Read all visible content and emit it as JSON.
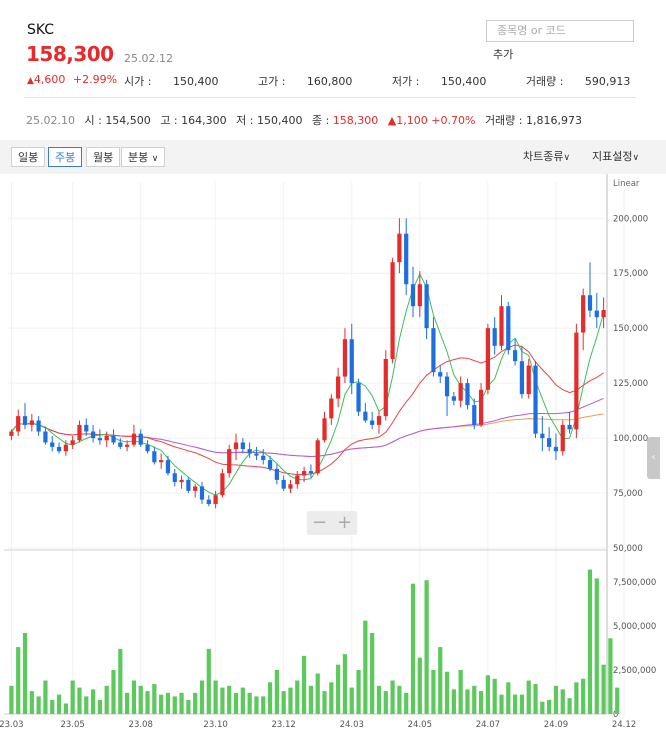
{
  "header": {
    "name": "SKC",
    "price": "158,300",
    "date": "25.02.12",
    "change": "4,600",
    "change_pct": "+2.99%",
    "open_label": "시가 :",
    "open": "150,400",
    "high_label": "고가 :",
    "high": "160,800",
    "low_label": "저가 :",
    "low": "150,400",
    "volume_label": "거래량 :",
    "volume": "590,913",
    "search_placeholder": "종목명 or 코드",
    "add_label": "추가"
  },
  "prev": {
    "date": "25.02.10",
    "open_label": "시 :",
    "open": "154,500",
    "high_label": "고 :",
    "high": "164,300",
    "low_label": "저 :",
    "low": "150,400",
    "close_label": "종 :",
    "close": "158,300",
    "change": "1,100",
    "change_pct": "+0.70%",
    "volume_label": "거래량 :",
    "volume": "1,816,973"
  },
  "toolbar": {
    "daily": "일봉",
    "weekly": "주봉",
    "monthly": "월봉",
    "minute": "분봉",
    "chart_type": "차트종류",
    "indicator": "지표설정"
  },
  "chart_data": {
    "type": "candlestick",
    "scale": "Linear",
    "price_axis": {
      "min": 50000,
      "max": 200000,
      "ticks": [
        50000,
        75000,
        100000,
        125000,
        150000,
        175000,
        200000
      ]
    },
    "volume_axis": {
      "min": 0,
      "max": 7500000,
      "ticks": [
        0,
        2500000,
        5000000,
        7500000
      ]
    },
    "x_ticks": [
      "23.03",
      "23.05",
      "23.08",
      "23.10",
      "23.12",
      "24.03",
      "24.05",
      "24.07",
      "24.09",
      "24.12"
    ],
    "x_tick_index": [
      0,
      9,
      19,
      30,
      40,
      50,
      60,
      70,
      80,
      90
    ],
    "colors": {
      "up": "#e52b2b",
      "down": "#1d6fe0",
      "volume": "#5cc95c",
      "ma5": "#3cbf5a",
      "ma20": "#e54848",
      "ma60": "#b25cdc",
      "ma120": "#f29b4c"
    },
    "candles": [
      {
        "o": 101000,
        "h": 104000,
        "l": 99000,
        "c": 103000
      },
      {
        "o": 103000,
        "h": 113000,
        "l": 101000,
        "c": 110000
      },
      {
        "o": 110000,
        "h": 116000,
        "l": 104000,
        "c": 106000
      },
      {
        "o": 106000,
        "h": 111000,
        "l": 103000,
        "c": 108000
      },
      {
        "o": 108000,
        "h": 110000,
        "l": 101000,
        "c": 103000
      },
      {
        "o": 103000,
        "h": 105000,
        "l": 97000,
        "c": 98000
      },
      {
        "o": 98000,
        "h": 101000,
        "l": 94000,
        "c": 96000
      },
      {
        "o": 96000,
        "h": 98000,
        "l": 93000,
        "c": 94000
      },
      {
        "o": 94000,
        "h": 99000,
        "l": 92000,
        "c": 97000
      },
      {
        "o": 97000,
        "h": 101000,
        "l": 95000,
        "c": 99000
      },
      {
        "o": 99000,
        "h": 108000,
        "l": 98000,
        "c": 106000
      },
      {
        "o": 106000,
        "h": 109000,
        "l": 101000,
        "c": 103000
      },
      {
        "o": 103000,
        "h": 106000,
        "l": 98000,
        "c": 100000
      },
      {
        "o": 100000,
        "h": 104000,
        "l": 97000,
        "c": 99000
      },
      {
        "o": 99000,
        "h": 103000,
        "l": 96000,
        "c": 101000
      },
      {
        "o": 101000,
        "h": 104000,
        "l": 97000,
        "c": 98000
      },
      {
        "o": 98000,
        "h": 100000,
        "l": 95000,
        "c": 96000
      },
      {
        "o": 96000,
        "h": 99000,
        "l": 94000,
        "c": 97000
      },
      {
        "o": 97000,
        "h": 106000,
        "l": 96000,
        "c": 102000
      },
      {
        "o": 102000,
        "h": 104000,
        "l": 96000,
        "c": 97000
      },
      {
        "o": 97000,
        "h": 99000,
        "l": 93000,
        "c": 94000
      },
      {
        "o": 94000,
        "h": 96000,
        "l": 88000,
        "c": 89000
      },
      {
        "o": 89000,
        "h": 93000,
        "l": 86000,
        "c": 90000
      },
      {
        "o": 90000,
        "h": 92000,
        "l": 83000,
        "c": 84000
      },
      {
        "o": 84000,
        "h": 86000,
        "l": 78000,
        "c": 80000
      },
      {
        "o": 80000,
        "h": 83000,
        "l": 77000,
        "c": 81000
      },
      {
        "o": 81000,
        "h": 82000,
        "l": 75000,
        "c": 76000
      },
      {
        "o": 76000,
        "h": 79000,
        "l": 73000,
        "c": 78000
      },
      {
        "o": 78000,
        "h": 80000,
        "l": 70000,
        "c": 72000
      },
      {
        "o": 72000,
        "h": 74000,
        "l": 69000,
        "c": 70000
      },
      {
        "o": 70000,
        "h": 76000,
        "l": 68000,
        "c": 74000
      },
      {
        "o": 74000,
        "h": 86000,
        "l": 73000,
        "c": 84000
      },
      {
        "o": 84000,
        "h": 97000,
        "l": 82000,
        "c": 95000
      },
      {
        "o": 95000,
        "h": 102000,
        "l": 90000,
        "c": 98000
      },
      {
        "o": 98000,
        "h": 100000,
        "l": 93000,
        "c": 95000
      },
      {
        "o": 95000,
        "h": 98000,
        "l": 91000,
        "c": 93000
      },
      {
        "o": 93000,
        "h": 96000,
        "l": 90000,
        "c": 92000
      },
      {
        "o": 92000,
        "h": 95000,
        "l": 88000,
        "c": 90000
      },
      {
        "o": 90000,
        "h": 92000,
        "l": 85000,
        "c": 86000
      },
      {
        "o": 86000,
        "h": 88000,
        "l": 79000,
        "c": 81000
      },
      {
        "o": 81000,
        "h": 83000,
        "l": 76000,
        "c": 77000
      },
      {
        "o": 77000,
        "h": 81000,
        "l": 75000,
        "c": 79000
      },
      {
        "o": 79000,
        "h": 85000,
        "l": 77000,
        "c": 83000
      },
      {
        "o": 83000,
        "h": 87000,
        "l": 80000,
        "c": 85000
      },
      {
        "o": 85000,
        "h": 88000,
        "l": 82000,
        "c": 84000
      },
      {
        "o": 84000,
        "h": 100000,
        "l": 83000,
        "c": 99000
      },
      {
        "o": 99000,
        "h": 112000,
        "l": 98000,
        "c": 109000
      },
      {
        "o": 109000,
        "h": 120000,
        "l": 106000,
        "c": 118000
      },
      {
        "o": 118000,
        "h": 132000,
        "l": 114000,
        "c": 128000
      },
      {
        "o": 128000,
        "h": 150000,
        "l": 125000,
        "c": 145000
      },
      {
        "o": 145000,
        "h": 152000,
        "l": 120000,
        "c": 125000
      },
      {
        "o": 125000,
        "h": 127000,
        "l": 110000,
        "c": 112000
      },
      {
        "o": 112000,
        "h": 116000,
        "l": 107000,
        "c": 108000
      },
      {
        "o": 108000,
        "h": 112000,
        "l": 104000,
        "c": 106000
      },
      {
        "o": 106000,
        "h": 112000,
        "l": 102000,
        "c": 110000
      },
      {
        "o": 110000,
        "h": 140000,
        "l": 108000,
        "c": 136000
      },
      {
        "o": 136000,
        "h": 182000,
        "l": 134000,
        "c": 180000
      },
      {
        "o": 180000,
        "h": 200000,
        "l": 175000,
        "c": 193000
      },
      {
        "o": 193000,
        "h": 200000,
        "l": 165000,
        "c": 170000
      },
      {
        "o": 170000,
        "h": 178000,
        "l": 155000,
        "c": 160000
      },
      {
        "o": 160000,
        "h": 176000,
        "l": 155000,
        "c": 170000
      },
      {
        "o": 170000,
        "h": 172000,
        "l": 145000,
        "c": 150000
      },
      {
        "o": 150000,
        "h": 155000,
        "l": 128000,
        "c": 130000
      },
      {
        "o": 130000,
        "h": 133000,
        "l": 125000,
        "c": 128000
      },
      {
        "o": 128000,
        "h": 130000,
        "l": 110000,
        "c": 119000
      },
      {
        "o": 119000,
        "h": 121000,
        "l": 115000,
        "c": 117000
      },
      {
        "o": 117000,
        "h": 128000,
        "l": 114000,
        "c": 125000
      },
      {
        "o": 125000,
        "h": 127000,
        "l": 113000,
        "c": 115000
      },
      {
        "o": 115000,
        "h": 118000,
        "l": 104000,
        "c": 106000
      },
      {
        "o": 106000,
        "h": 125000,
        "l": 105000,
        "c": 122000
      },
      {
        "o": 122000,
        "h": 152000,
        "l": 120000,
        "c": 150000
      },
      {
        "o": 150000,
        "h": 155000,
        "l": 138000,
        "c": 142000
      },
      {
        "o": 142000,
        "h": 165000,
        "l": 140000,
        "c": 160000
      },
      {
        "o": 160000,
        "h": 162000,
        "l": 138000,
        "c": 140000
      },
      {
        "o": 140000,
        "h": 145000,
        "l": 133000,
        "c": 135000
      },
      {
        "o": 135000,
        "h": 142000,
        "l": 118000,
        "c": 120000
      },
      {
        "o": 120000,
        "h": 136000,
        "l": 118000,
        "c": 133000
      },
      {
        "o": 133000,
        "h": 135000,
        "l": 100000,
        "c": 102000
      },
      {
        "o": 102000,
        "h": 110000,
        "l": 94000,
        "c": 100000
      },
      {
        "o": 100000,
        "h": 105000,
        "l": 94000,
        "c": 96000
      },
      {
        "o": 96000,
        "h": 102000,
        "l": 90000,
        "c": 94000
      },
      {
        "o": 94000,
        "h": 108000,
        "l": 92000,
        "c": 106000
      },
      {
        "o": 106000,
        "h": 112000,
        "l": 102000,
        "c": 104000
      },
      {
        "o": 104000,
        "h": 152000,
        "l": 100000,
        "c": 148000
      },
      {
        "o": 148000,
        "h": 168000,
        "l": 140000,
        "c": 165000
      },
      {
        "o": 165000,
        "h": 180000,
        "l": 155000,
        "c": 158000
      },
      {
        "o": 158000,
        "h": 166000,
        "l": 150000,
        "c": 155000
      },
      {
        "o": 155000,
        "h": 164000,
        "l": 150000,
        "c": 158300
      }
    ],
    "volumes": [
      1600000,
      3800000,
      4600000,
      1300000,
      1000000,
      1900000,
      800000,
      1100000,
      600000,
      1900000,
      1500000,
      1000000,
      1400000,
      800000,
      1600000,
      2500000,
      3700000,
      1200000,
      1900000,
      1600000,
      1300000,
      1700000,
      1100000,
      1200000,
      1000000,
      1200000,
      800000,
      1200000,
      1900000,
      3700000,
      1900000,
      1500000,
      1600000,
      1200000,
      1500000,
      1200000,
      1000000,
      1000000,
      1800000,
      2500000,
      1300000,
      1500000,
      1900000,
      3300000,
      1600000,
      2300000,
      1300000,
      1800000,
      2800000,
      3400000,
      1500000,
      2500000,
      5300000,
      4600000,
      1600000,
      1300000,
      1900000,
      1600000,
      1200000,
      7400000,
      3200000,
      7600000,
      2500000,
      3800000,
      2400000,
      1400000,
      2500000,
      1400000,
      1600000,
      1300000,
      2200000,
      2000000,
      1100000,
      1800000,
      1100000,
      1100000,
      1900000,
      1700000,
      700000,
      800000,
      1600000,
      1400000,
      900000,
      1800000,
      2000000,
      8200000,
      7700000,
      2800000,
      4300000,
      1500000
    ]
  }
}
